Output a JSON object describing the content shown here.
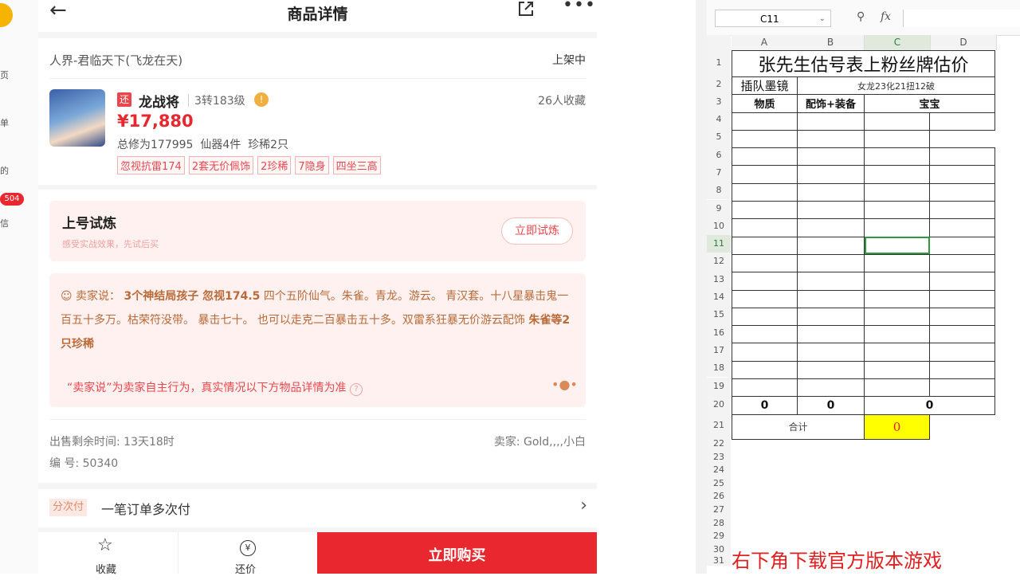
{
  "left_strip": {
    "labels": [
      "页",
      "单",
      "的",
      "信"
    ],
    "badge": "504"
  },
  "nav": {
    "title": "商品详情"
  },
  "item": {
    "server": "人界-君临天下(飞龙在天)",
    "status": "上架中",
    "badge_char": "还",
    "name": "龙战将",
    "level": "3转183级",
    "favorites": "26人收藏",
    "price": "¥17,880",
    "stats": "总修为177995  仙器4件  珍稀2只",
    "tags": [
      "忽视抗雷174",
      "2套无价佩饰",
      "2珍稀",
      "7隐身",
      "四坐三高"
    ]
  },
  "trial": {
    "title": "上号试炼",
    "subtitle": "感受实战效果，先试后买",
    "button": "立即试炼"
  },
  "seller_says": {
    "label": "卖家说：",
    "bold1": "3个神结局孩子 忽视174.5",
    "text1": "四个五阶仙气。朱雀。青龙。游云。 青汉套。十八星暴击鬼一百五十多万。枯荣符没带。 暴击七十。 也可以走克二百暴击五十多。双雷系狂暴无价游云配饰",
    "bold2": "朱雀等2只珍稀",
    "disclaimer": "“卖家说”为卖家自主行为，真实情况以下方物品详情为准"
  },
  "sale": {
    "remaining": "出售剩余时间: 13天18时",
    "seller": "卖家: Gold,,,,小白",
    "number": "编 号: 50340"
  },
  "installment": {
    "badge": "分次付",
    "text": "一笔订单多次付"
  },
  "bottom_bar": {
    "favorite": "收藏",
    "bargain": "还价",
    "buy": "立即购买"
  },
  "excel": {
    "cell_ref": "C11",
    "fx": "fx",
    "columns": [
      "A",
      "B",
      "C",
      "D"
    ],
    "title": "张先生估号表上粉丝牌估价",
    "row2_a": "插队墨镜",
    "row2_bcd": "女龙23化21扭12破",
    "headers": [
      "物质",
      "配饰+装备",
      "宝宝"
    ],
    "totals": [
      "0",
      "0",
      "0"
    ],
    "sum_label": "合计",
    "sum_value": "0",
    "row_numbers": [
      "1",
      "2",
      "3",
      "4",
      "5",
      "6",
      "7",
      "8",
      "9",
      "10",
      "11",
      "12",
      "13",
      "14",
      "15",
      "16",
      "17",
      "18",
      "19",
      "20",
      "21",
      "22",
      "23",
      "24",
      "25",
      "26",
      "27",
      "28",
      "29",
      "30",
      "31"
    ],
    "bottom_text": "右下角下载官方版本游戏",
    "colors": {
      "highlight": "#ffff00",
      "selected_border": "#2e9a3e",
      "red": "#e02020"
    }
  }
}
